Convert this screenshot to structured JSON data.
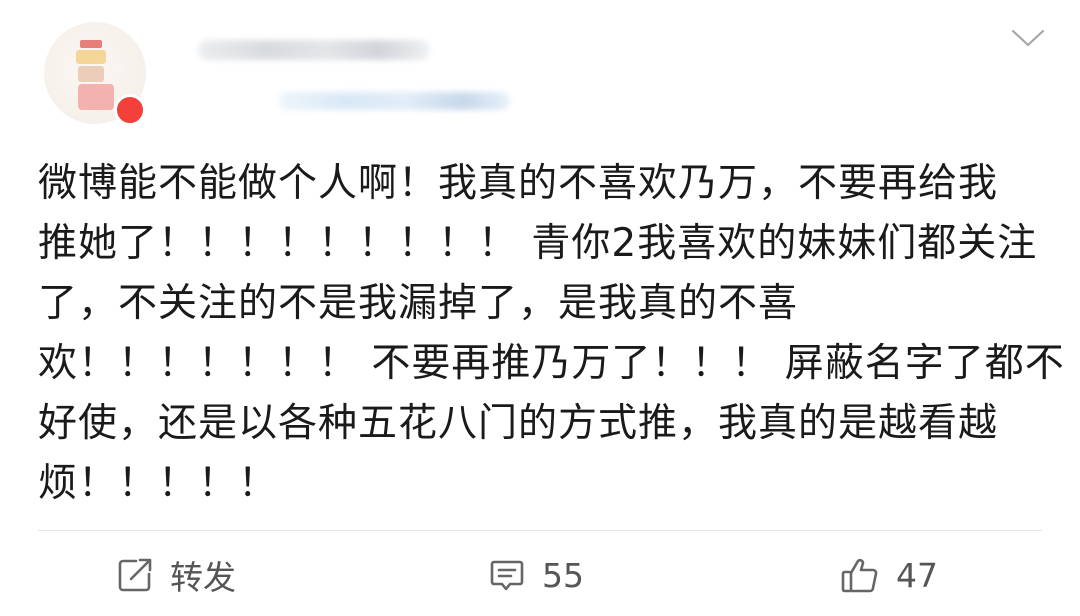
{
  "post": {
    "text_lines": [
      "微博能不能做个人啊！我真的不喜欢乃万，不要再给我",
      "推她了！！！！！！！！！ 青你2我喜欢的妹妹们都关注",
      "了，不关注的不是我漏掉了，是我真的不喜",
      "欢！！！！！！！ 不要再推乃万了！！！ 屏蔽名字了都不",
      "好使，还是以各种五花八门的方式推，我真的是越看越",
      "烦！！！！！"
    ]
  },
  "actions": {
    "repost_label": "转发",
    "comment_count": "55",
    "like_count": "47"
  },
  "icons": {
    "menu": "chevron-down-icon",
    "repost": "repost-icon",
    "comment": "comment-icon",
    "like": "thumbs-up-icon"
  },
  "colors": {
    "text": "#1a1a1a",
    "action_text": "#555555",
    "divider": "#e6e6e6",
    "badge": "#f2403a"
  }
}
